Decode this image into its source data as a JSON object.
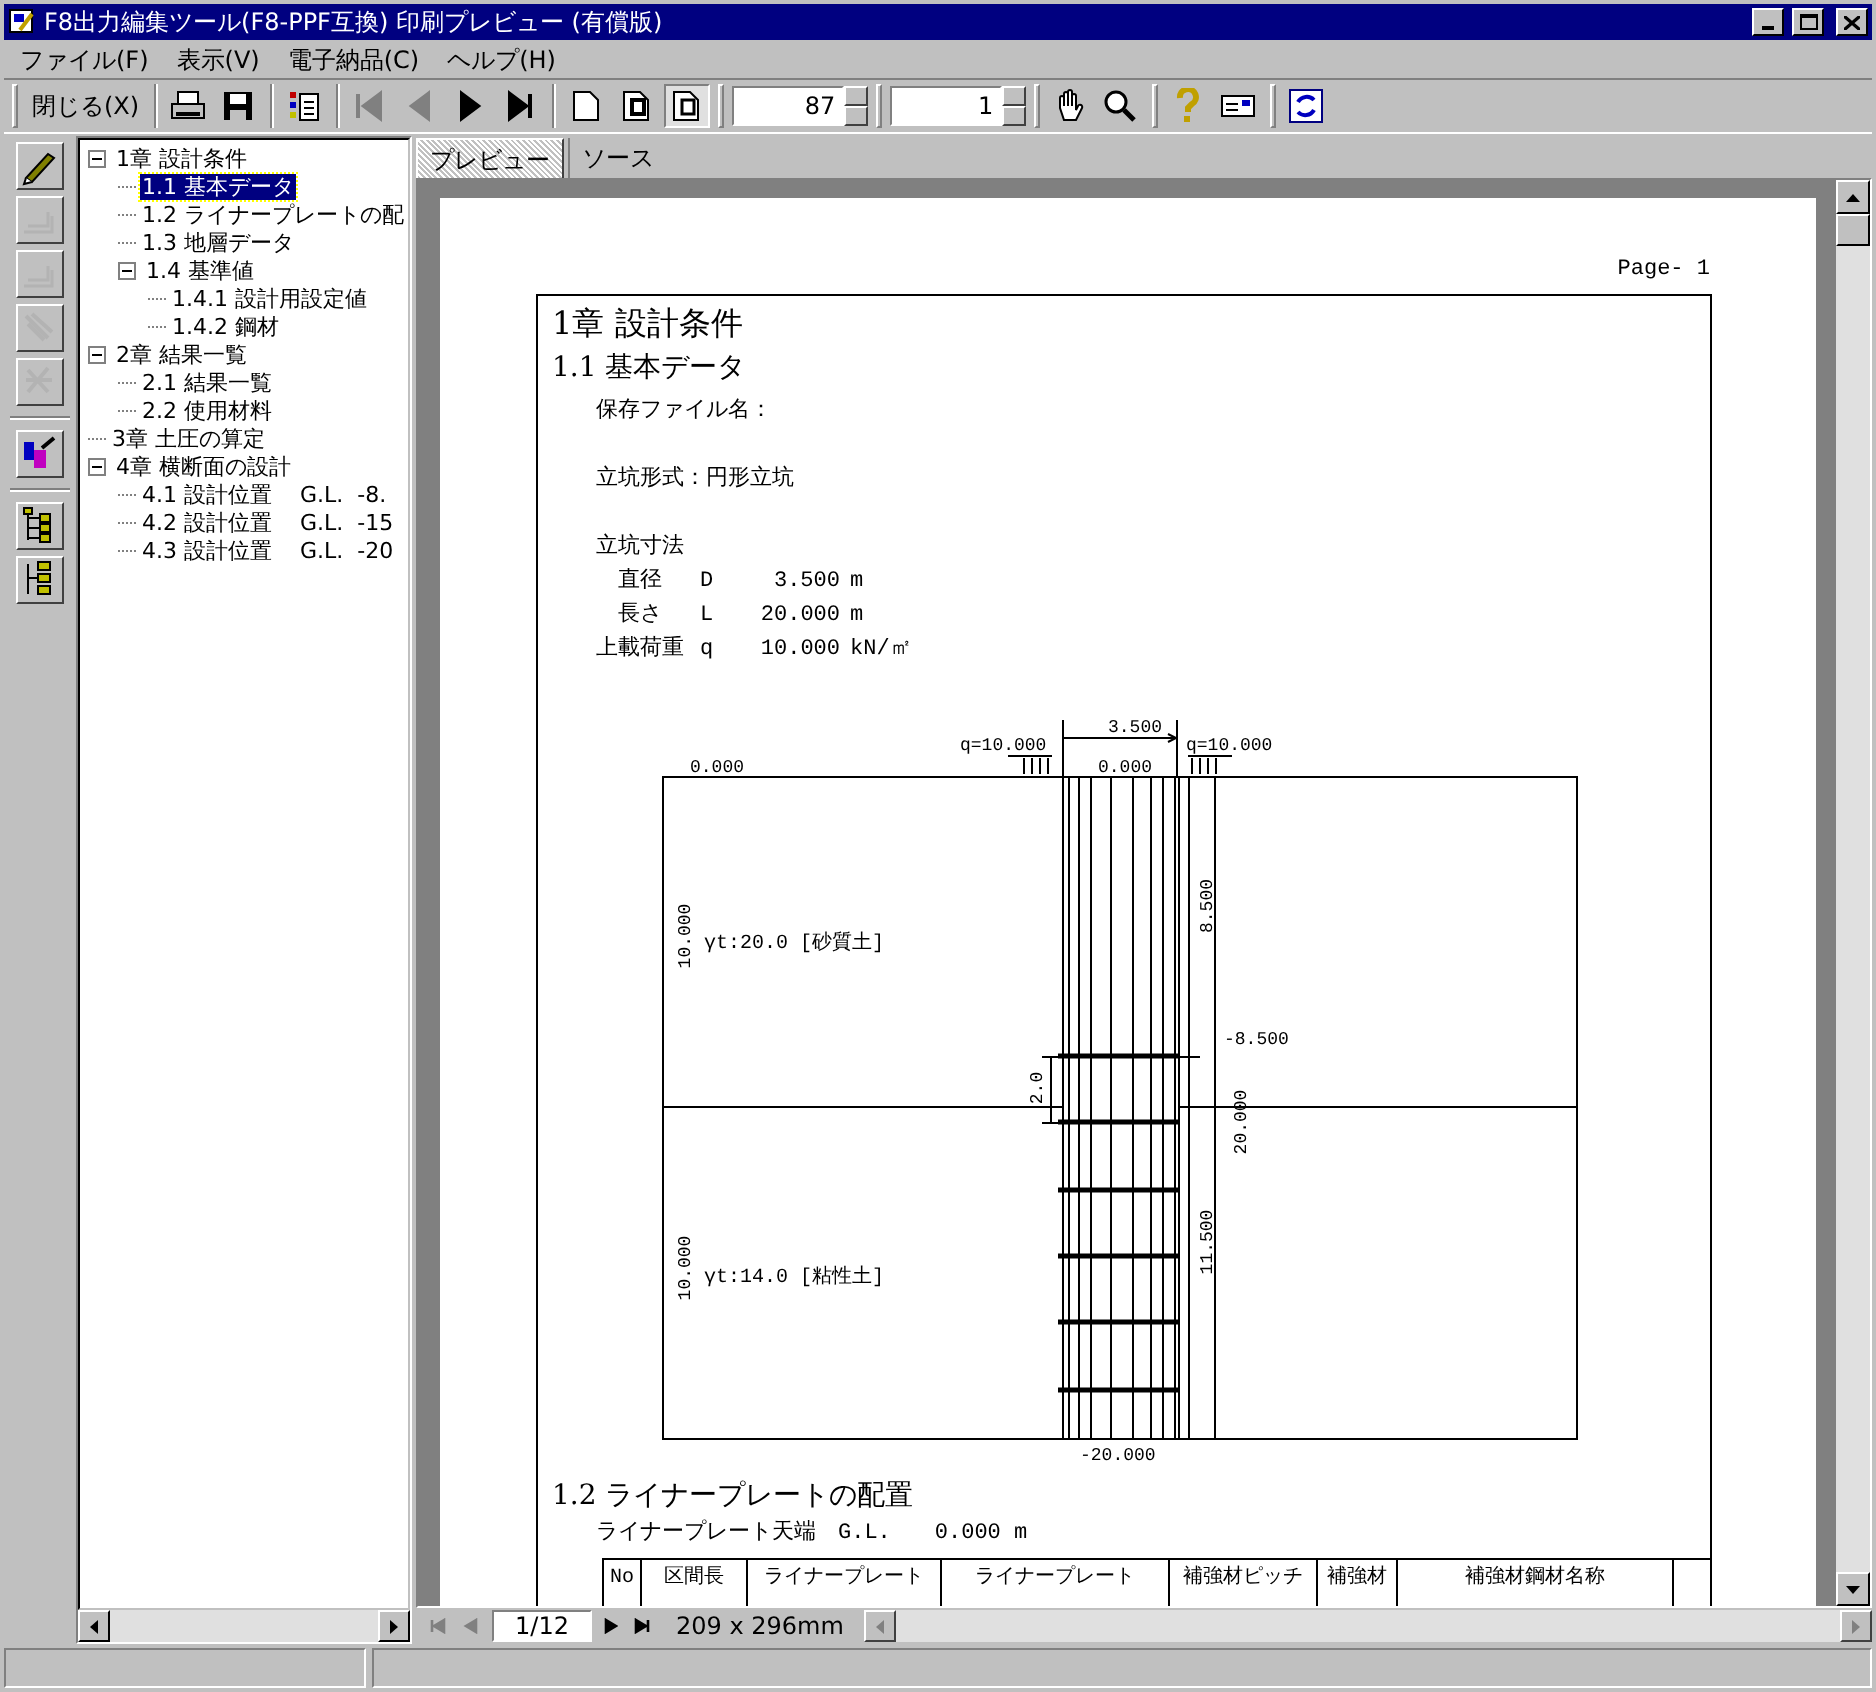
{
  "window": {
    "title": "F8出力編集ツール(F8-PPF互換) 印刷プレビュー (有償版)"
  },
  "menu": [
    "ファイル(F)",
    "表示(V)",
    "電子納品(C)",
    "ヘルプ(H)"
  ],
  "toolbar": {
    "close_button": "閉じる(X)",
    "nav_buttons": [
      {
        "disabled": true
      },
      {
        "disabled": true
      },
      {
        "disabled": false
      },
      {
        "disabled": false
      }
    ],
    "view_buttons": [
      {
        "selected": false
      },
      {
        "selected": false
      },
      {
        "selected": true
      }
    ],
    "zoom": "87",
    "page": "1"
  },
  "side_toolbar": [
    {
      "disabled": false
    },
    {
      "disabled": true
    },
    {
      "disabled": true
    },
    {
      "disabled": true
    },
    {
      "disabled": true
    },
    {
      "disabled": false
    },
    {
      "disabled": false
    },
    {
      "disabled": false
    }
  ],
  "tree": [
    {
      "label": "1章 設計条件",
      "expanded": true,
      "selected": false,
      "children": [
        {
          "label": "1.1 基本データ",
          "selected": true
        },
        {
          "label": "1.2 ライナープレートの配",
          "selected": false
        },
        {
          "label": "1.3 地層データ",
          "selected": false
        },
        {
          "label": "1.4 基準値",
          "expanded": true,
          "selected": false,
          "children": [
            {
              "label": "1.4.1 設計用設定値",
              "selected": false
            },
            {
              "label": "1.4.2 鋼材",
              "selected": false
            }
          ]
        }
      ]
    },
    {
      "label": "2章 結果一覧",
      "expanded": true,
      "selected": false,
      "children": [
        {
          "label": "2.1 結果一覧",
          "selected": false
        },
        {
          "label": "2.2 使用材料",
          "selected": false
        }
      ]
    },
    {
      "label": "3章 土圧の算定",
      "selected": false
    },
    {
      "label": "4章 横断面の設計",
      "expanded": true,
      "selected": false,
      "children": [
        {
          "label": "4.1 設計位置    G.L.  -8.",
          "selected": false
        },
        {
          "label": "4.2 設計位置    G.L.  -15",
          "selected": false
        },
        {
          "label": "4.3 設計位置    G.L.  -20",
          "selected": false
        }
      ]
    }
  ],
  "tabs": [
    {
      "label": "プレビュー",
      "selected": true
    },
    {
      "label": "ソース",
      "selected": false
    }
  ],
  "page": {
    "page_label": "Page- 1",
    "chapter_title": "1章 設計条件",
    "section_title": "1.1 基本データ",
    "fields": [
      "保存ファイル名：",
      "立坑形式：円形立坑"
    ],
    "shaft_dimensions": {
      "heading": "立坑寸法",
      "rows": [
        {
          "label": "直径",
          "symbol": "D",
          "value": "3.500",
          "unit": "m"
        },
        {
          "label": "長さ",
          "symbol": "L",
          "value": "20.000",
          "unit": "m"
        }
      ]
    },
    "surcharge": {
      "label": "上載荷重",
      "symbol": "q",
      "value": "10.000",
      "unit": "kN/㎡"
    },
    "diagram": {
      "labels": [
        "3.500",
        "q=10.000",
        "q=10.000",
        "0.000",
        "0.000",
        "8.500",
        "10.000",
        "γt:20.0 [砂質土]",
        "-8.500",
        "2.0",
        "20.000",
        "10.000",
        "γt:14.0 [粘性土]",
        "11.500",
        "-20.000"
      ]
    },
    "section2_title": "1.2 ライナープレートの配置",
    "liner_top": "ライナープレート天端　G.L.　　0.000 m",
    "table": {
      "columns": [
        "No",
        "区間長",
        "ライナープレート",
        "ライナープレート",
        "補強材ピッチ",
        "補強材",
        "補強材鋼材名称"
      ]
    }
  },
  "page_nav": {
    "buttons": [
      {
        "disabled": true
      },
      {
        "disabled": true
      },
      {
        "disabled": false
      },
      {
        "disabled": false
      }
    ],
    "page": "1/12",
    "paper_size": "209 x 296mm"
  }
}
